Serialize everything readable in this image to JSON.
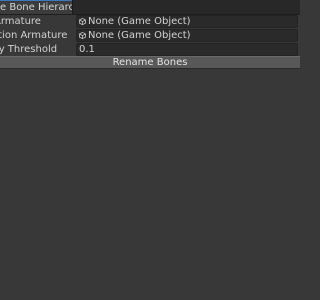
{
  "tab": {
    "title": "e Bone Hierarchy"
  },
  "properties": [
    {
      "label": "Armature",
      "value": "None (Game Object)",
      "icon": "gameobject-icon"
    },
    {
      "label": "ation Armature",
      "value": "None (Game Object)",
      "icon": "gameobject-icon"
    },
    {
      "label": "ity Threshold",
      "value": "0.1"
    }
  ],
  "actions": {
    "rename_label": "Rename Bones"
  },
  "colors": {
    "background": "#383838",
    "field": "#2a2a2a",
    "button": "#585858",
    "tab_accent": "#3a79bb"
  }
}
